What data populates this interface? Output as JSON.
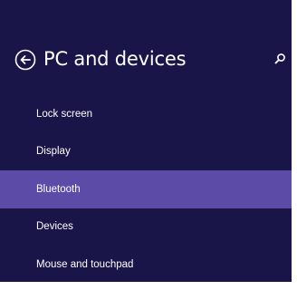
{
  "header": {
    "title": "PC and devices",
    "back_icon": "back-arrow-icon",
    "search_icon": "search-icon"
  },
  "colors": {
    "panel_background": "#1a1548",
    "selected_background": "#5d4ba8",
    "text": "#ffffff"
  },
  "nav": {
    "items": [
      {
        "label": "Lock screen",
        "selected": false
      },
      {
        "label": "Display",
        "selected": false
      },
      {
        "label": "Bluetooth",
        "selected": true
      },
      {
        "label": "Devices",
        "selected": false
      },
      {
        "label": "Mouse and touchpad",
        "selected": false
      }
    ]
  }
}
